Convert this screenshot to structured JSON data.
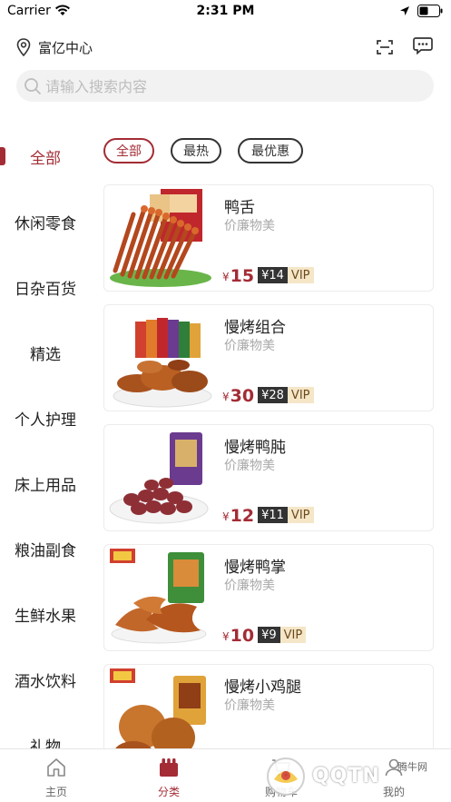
{
  "status_bar": {
    "carrier": "Carrier",
    "time": "2:31 PM"
  },
  "header": {
    "location": "富亿中心"
  },
  "search": {
    "placeholder": "请输入搜索内容"
  },
  "sidebar": {
    "items": [
      {
        "label": "全部"
      },
      {
        "label": "休闲零食"
      },
      {
        "label": "日杂百货"
      },
      {
        "label": "精选"
      },
      {
        "label": "个人护理"
      },
      {
        "label": "床上用品"
      },
      {
        "label": "粮油副食"
      },
      {
        "label": "生鲜水果"
      },
      {
        "label": "酒水饮料"
      },
      {
        "label": "礼物"
      }
    ],
    "active_index": 0
  },
  "filters": [
    {
      "label": "全部"
    },
    {
      "label": "最热"
    },
    {
      "label": "最优惠"
    }
  ],
  "products": [
    {
      "name": "鸭舌",
      "subtitle": "价廉物美",
      "currency": "¥",
      "price": "15",
      "vip_price": "¥14",
      "vip_label": "VIP"
    },
    {
      "name": "慢烤组合",
      "subtitle": "价廉物美",
      "currency": "¥",
      "price": "30",
      "vip_price": "¥28",
      "vip_label": "VIP"
    },
    {
      "name": "慢烤鸭肫",
      "subtitle": "价廉物美",
      "currency": "¥",
      "price": "12",
      "vip_price": "¥11",
      "vip_label": "VIP"
    },
    {
      "name": "慢烤鸭掌",
      "subtitle": "价廉物美",
      "currency": "¥",
      "price": "10",
      "vip_price": "¥9",
      "vip_label": "VIP"
    },
    {
      "name": "慢烤小鸡腿",
      "subtitle": "价廉物美",
      "currency": "¥",
      "price": "",
      "vip_price": "",
      "vip_label": ""
    }
  ],
  "tabbar": {
    "tabs": [
      {
        "label": "主页"
      },
      {
        "label": "分类"
      },
      {
        "label": "购物车"
      },
      {
        "label": "我的"
      }
    ],
    "active_index": 1
  },
  "watermark": {
    "text": "QQTN",
    "site": "腾牛网"
  },
  "colors": {
    "accent": "#a32c35",
    "text": "#222222",
    "muted": "#a9a9a9"
  }
}
